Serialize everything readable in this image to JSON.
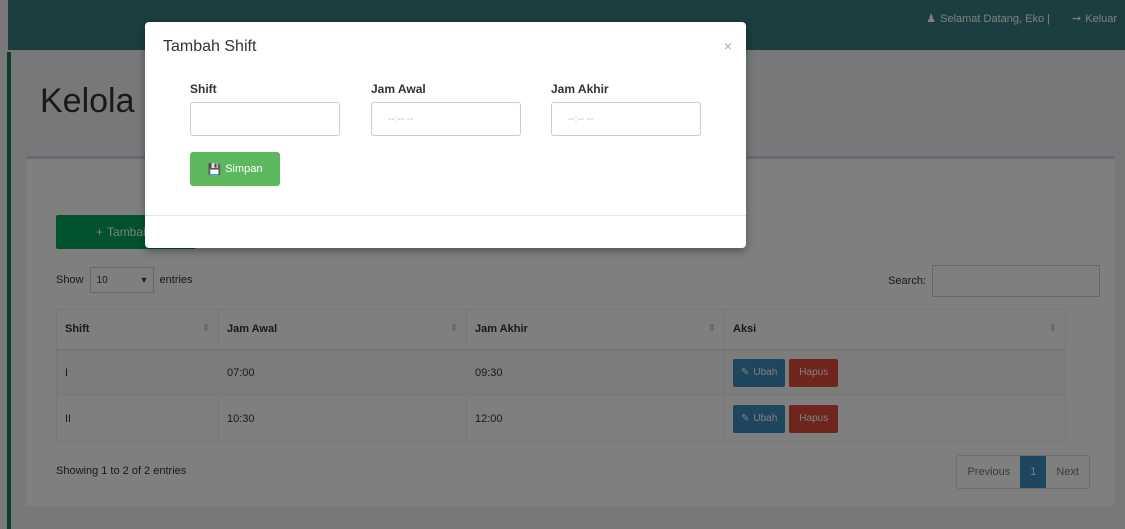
{
  "navbar": {
    "welcome": "Selamat Datang, Eko |",
    "logout": "Keluar"
  },
  "page": {
    "title": "Kelola Shift"
  },
  "toolbar": {
    "add_label": "Tambah"
  },
  "datatable": {
    "show_label": "Show",
    "length_value": "10",
    "entries_label": "entries",
    "search_label": "Search:",
    "columns": [
      "Shift",
      "Jam Awal",
      "Jam Akhir",
      "Aksi"
    ],
    "rows": [
      {
        "shift": "I",
        "jam_awal": "07:00",
        "jam_akhir": "09:30",
        "edit": "Ubah",
        "delete": "Hapus"
      },
      {
        "shift": "II",
        "jam_awal": "10:30",
        "jam_akhir": "12:00",
        "edit": "Ubah",
        "delete": "Hapus"
      }
    ],
    "info": "Showing 1 to 2 of 2 entries",
    "pagination": {
      "previous": "Previous",
      "page": "1",
      "next": "Next"
    }
  },
  "modal": {
    "title": "Tambah Shift",
    "close": "×",
    "fields": [
      {
        "label": "Shift",
        "placeholder": ""
      },
      {
        "label": "Jam Awal",
        "placeholder": "--:-- --"
      },
      {
        "label": "Jam Akhir",
        "placeholder": "--:-- --"
      }
    ],
    "save_label": "Simpan"
  },
  "colors": {
    "navbar": "#367c82",
    "success": "#00a65a",
    "primary": "#3c8dbc",
    "danger": "#dd4b39",
    "save": "#5cb85c"
  },
  "icons": [
    "user-icon",
    "logout-icon",
    "plus-icon",
    "edit-icon",
    "save-icon",
    "sort-icon",
    "caret-down-icon",
    "close-icon"
  ]
}
